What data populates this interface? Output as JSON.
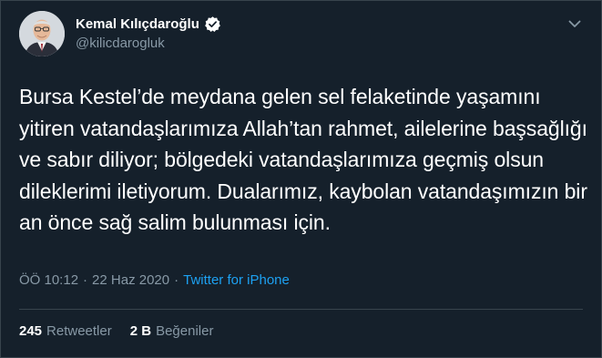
{
  "author": {
    "display_name": "Kemal Kılıçdaroğlu",
    "handle": "@kilicdarogluk",
    "verified": true
  },
  "tweet": {
    "text": "Bursa Kestel’de meydana gelen sel felaketinde yaşamını yitiren vatandaşlarımıza Allah’tan rahmet, ailelerine başsağlığı ve sabır diliyor; bölgedeki vatandaşlarımıza geçmiş olsun dileklerimi iletiyorum. Dualarımız, kaybolan vatandaşımızın bir an önce sağ salim bulunması için.",
    "time": "ÖÖ 10:12",
    "separator": "·",
    "date": "22 Haz 2020",
    "source": "Twitter for iPhone"
  },
  "stats": {
    "retweets_count": "245",
    "retweets_label": "Retweetler",
    "likes_count": "2 B",
    "likes_label": "Beğeniler"
  },
  "icons": {
    "verified": "verified-badge-icon",
    "menu": "chevron-down-icon"
  },
  "colors": {
    "background": "#15202b",
    "border": "#38444d",
    "secondary_text": "#8899a6",
    "accent": "#1da1f2"
  }
}
